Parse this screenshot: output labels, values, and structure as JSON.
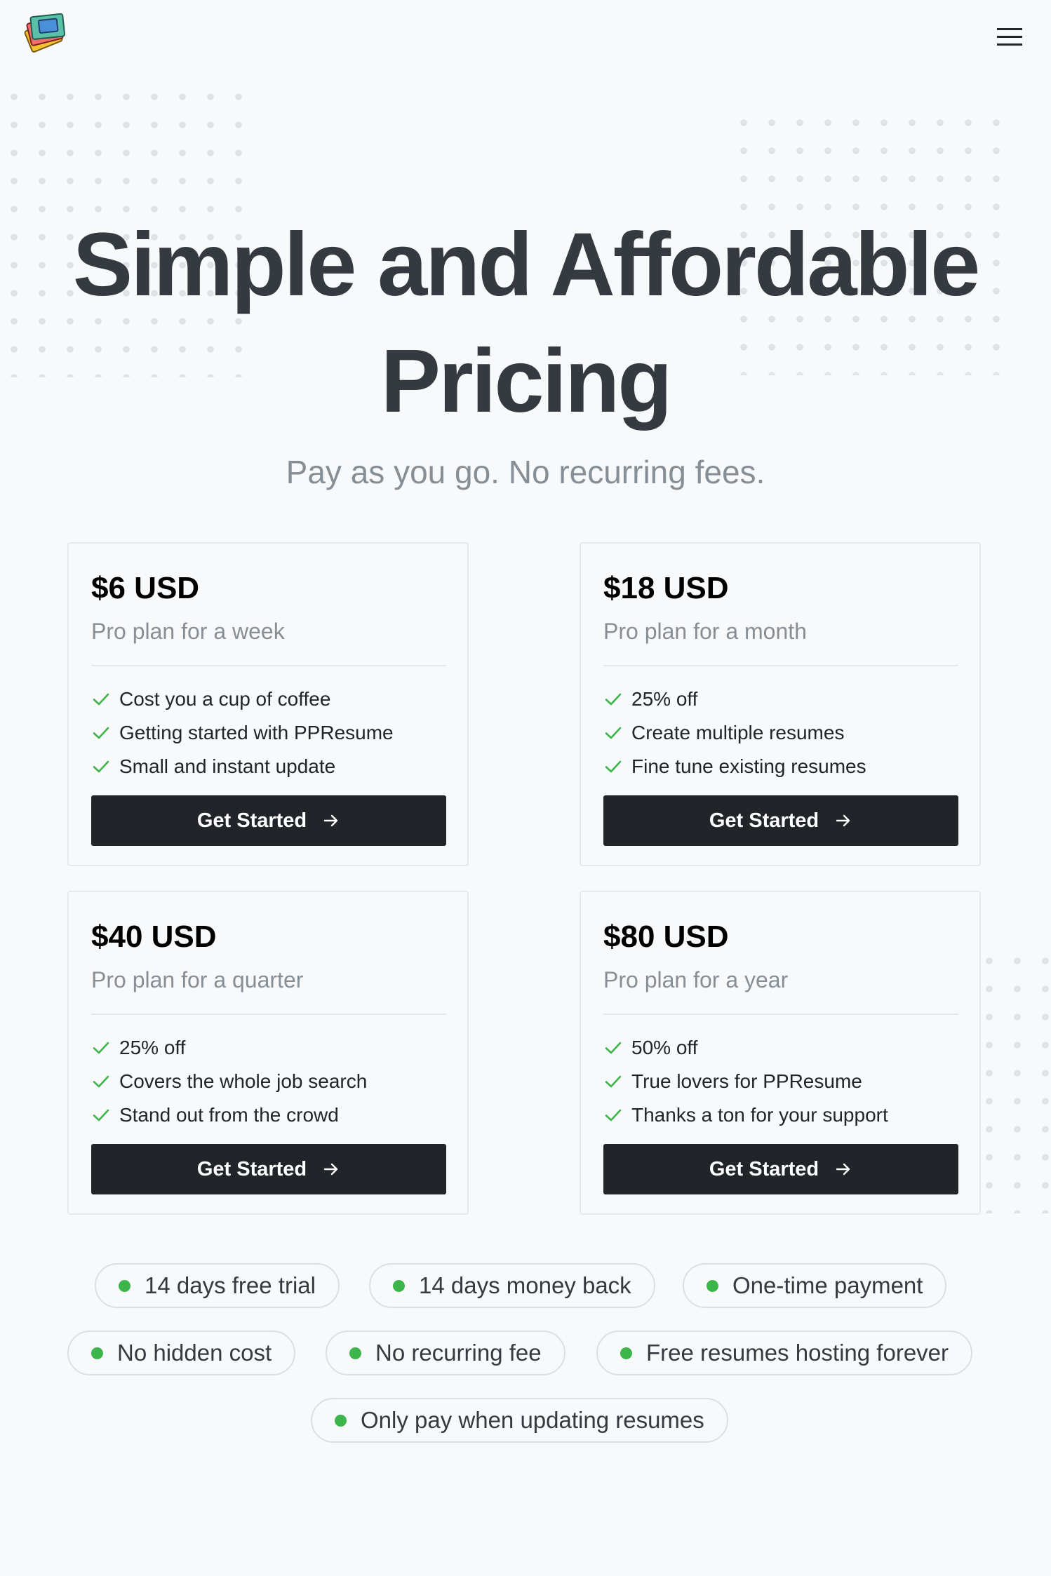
{
  "header": {
    "logo_icon": "ppresume-logo-icon",
    "menu_icon": "hamburger-menu-icon"
  },
  "hero": {
    "title_line1": "Simple and Affordable",
    "title_line2": "Pricing",
    "subtitle": "Pay as you go. No recurring fees."
  },
  "plans": [
    {
      "price": "$6 USD",
      "description": "Pro plan for a week",
      "features": [
        "Cost you a cup of coffee",
        "Getting started with PPResume",
        "Small and instant update"
      ],
      "cta_label": "Get Started"
    },
    {
      "price": "$18 USD",
      "description": "Pro plan for a month",
      "features": [
        "25% off",
        "Create multiple resumes",
        "Fine tune existing resumes"
      ],
      "cta_label": "Get Started"
    },
    {
      "price": "$40 USD",
      "description": "Pro plan for a quarter",
      "features": [
        "25% off",
        "Covers the whole job search",
        "Stand out from the crowd"
      ],
      "cta_label": "Get Started"
    },
    {
      "price": "$80 USD",
      "description": "Pro plan for a year",
      "features": [
        "50% off",
        "True lovers for PPResume",
        "Thanks a ton for your support"
      ],
      "cta_label": "Get Started"
    }
  ],
  "badges": [
    "14 days free trial",
    "14 days money back",
    "One-time payment",
    "No hidden cost",
    "No recurring fee",
    "Free resumes hosting forever",
    "Only pay when updating resumes"
  ],
  "colors": {
    "background": "#f8f9fa",
    "button": "#212529",
    "check": "#3cb54a",
    "badge_dot": "#3cb54a",
    "muted_text": "#868e96"
  }
}
